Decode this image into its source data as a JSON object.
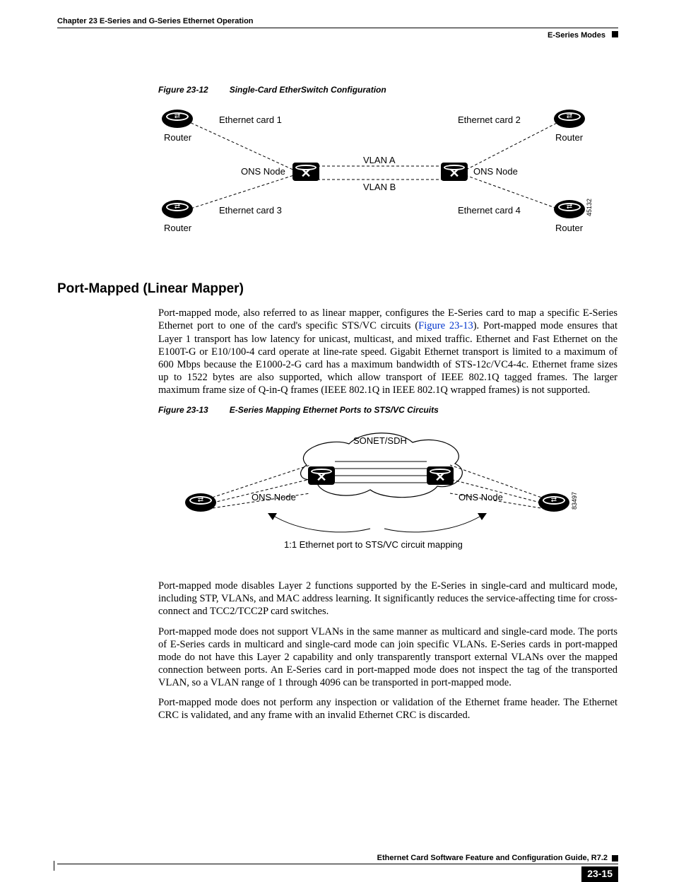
{
  "header": {
    "chapter_line": "Chapter 23     E-Series and G-Series Ethernet Operation",
    "section_name": "E-Series Modes"
  },
  "figure12": {
    "caption_num": "Figure 23-12",
    "caption_text": "Single-Card EtherSwitch Configuration",
    "labels": {
      "ec1": "Ethernet card 1",
      "ec2": "Ethernet card 2",
      "ec3": "Ethernet card 3",
      "ec4": "Ethernet card 4",
      "router": "Router",
      "ons": "ONS Node",
      "vlana": "VLAN A",
      "vlanb": "VLAN B",
      "imgnum": "45132"
    }
  },
  "section": {
    "heading": "Port-Mapped (Linear Mapper)",
    "p1a": "Port-mapped mode, also referred to as linear mapper, configures the E-Series card to map a specific E-Series Ethernet port to one of the card's specific STS/VC circuits (",
    "p1_link": "Figure 23-13",
    "p1b": "). Port-mapped mode ensures that Layer 1 transport has low latency for unicast, multicast, and mixed traffic. Ethernet and Fast Ethernet on the E100T-G or E10/100-4 card operate at line-rate speed. Gigabit Ethernet transport is limited to a maximum of 600 Mbps because the E1000-2-G card has a maximum bandwidth of STS-12c/VC4-4c. Ethernet frame sizes up to 1522 bytes are also supported, which allow transport of IEEE 802.1Q tagged frames. The larger maximum frame size of Q-in-Q frames (IEEE 802.1Q in IEEE 802.1Q wrapped frames) is not supported.",
    "p2": "Port-mapped mode disables Layer 2 functions supported by the E-Series in single-card and multicard mode, including STP, VLANs, and MAC address learning. It significantly reduces the service-affecting time for cross-connect and TCC2/TCC2P card switches.",
    "p3": "Port-mapped mode does not support VLANs in the same manner as multicard and single-card mode. The ports of E-Series cards in multicard and single-card mode can join specific VLANs. E-Series cards in port-mapped mode do not have this Layer 2 capability and only transparently transport external VLANs over the mapped connection between ports. An E-Series card in port-mapped mode does not inspect the tag of the transported VLAN, so a VLAN range of 1 through 4096 can be transported in port-mapped mode.",
    "p4": "Port-mapped mode does not perform any inspection or validation of the Ethernet frame header. The Ethernet CRC is validated, and any frame with an invalid Ethernet CRC is discarded."
  },
  "figure13": {
    "caption_num": "Figure 23-13",
    "caption_text": "E-Series Mapping Ethernet Ports to STS/VC Circuits",
    "labels": {
      "sonet": "SONET/SDH",
      "ons": "ONS Node",
      "mapping": "1:1 Ethernet port to STS/VC circuit mapping",
      "imgnum": "83497"
    }
  },
  "footer": {
    "title": "Ethernet Card Software Feature and Configuration Guide, R7.2",
    "page": "23-15"
  },
  "chart_data": null
}
